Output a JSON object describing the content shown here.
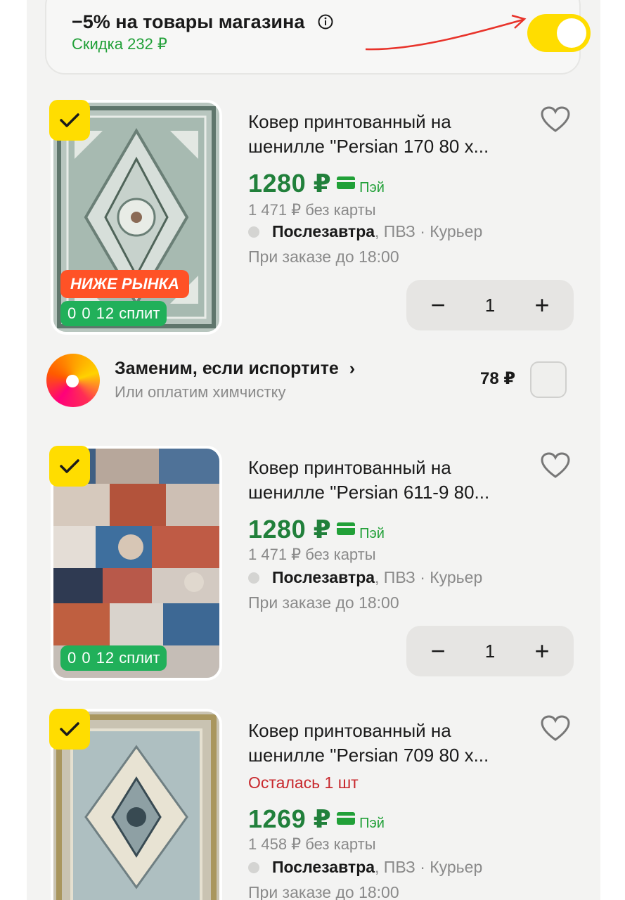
{
  "discount": {
    "title": "−5% на товары магазина",
    "subtitle": "Скидка 232 ₽",
    "toggle_on": true,
    "info_icon": "info-icon"
  },
  "products": [
    {
      "title_line1": "Ковер принтованный на",
      "title_line2": "шенилле \"Persian 170 80 х...",
      "badge_market": "НИЖЕ РЫНКА",
      "split_num": "0 0 12",
      "split_label": "сплит",
      "price": "1280 ₽",
      "pay_label": "Пэй",
      "old_price": "1 471 ₽  без карты",
      "delivery_day": "Послезавтра",
      "delivery_rest": ", ПВЗ · Курьер",
      "order_time": "При заказе до 18:00",
      "quantity": "1",
      "selected": true
    },
    {
      "title_line1": "Ковер принтованный на",
      "title_line2": "шенилле \"Persian 611-9 80...",
      "split_num": "0 0 12",
      "split_label": "сплит",
      "price": "1280 ₽",
      "pay_label": "Пэй",
      "old_price": "1 471 ₽  без карты",
      "delivery_day": "Послезавтра",
      "delivery_rest": ", ПВЗ · Курьер",
      "order_time": "При заказе до 18:00",
      "quantity": "1",
      "selected": true
    },
    {
      "title_line1": "Ковер принтованный на",
      "title_line2": "шенилле \"Persian 709 80 х...",
      "stock": "Осталась 1 шт",
      "price": "1269 ₽",
      "pay_label": "Пэй",
      "old_price": "1 458 ₽  без карты",
      "delivery_day": "Послезавтра",
      "delivery_rest": ", ПВЗ · Курьер",
      "order_time": "При заказе до 18:00",
      "selected": true
    }
  ],
  "insurance": {
    "title": "Заменим, если испортите",
    "chevron": "›",
    "subtitle": "Или оплатим химчистку",
    "price": "78 ₽"
  },
  "stepper": {
    "minus": "−",
    "plus": "+"
  },
  "colors": {
    "accent_yellow": "#ffdd00",
    "price_green": "#21803b",
    "discount_green": "#21a038",
    "badge_orange": "#ff5226",
    "split_green": "#21b05a",
    "stock_red": "#c8282d"
  }
}
